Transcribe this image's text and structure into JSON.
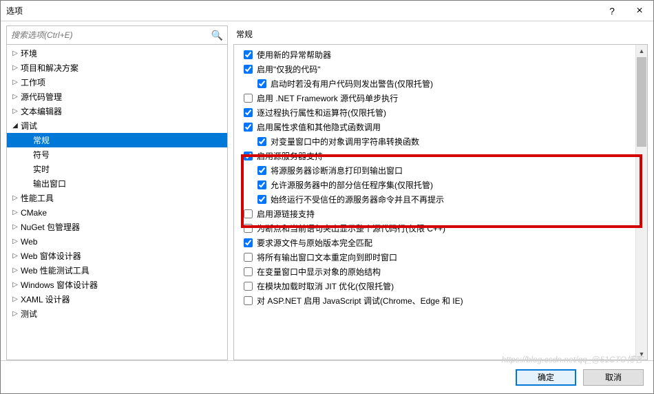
{
  "window": {
    "title": "选项",
    "help": "?",
    "close": "×"
  },
  "search": {
    "placeholder": "搜索选项(Ctrl+E)"
  },
  "tree": [
    {
      "label": "环境",
      "depth": 0,
      "expandable": true,
      "expanded": false
    },
    {
      "label": "项目和解决方案",
      "depth": 0,
      "expandable": true,
      "expanded": false
    },
    {
      "label": "工作项",
      "depth": 0,
      "expandable": true,
      "expanded": false
    },
    {
      "label": "源代码管理",
      "depth": 0,
      "expandable": true,
      "expanded": false
    },
    {
      "label": "文本编辑器",
      "depth": 0,
      "expandable": true,
      "expanded": false
    },
    {
      "label": "调试",
      "depth": 0,
      "expandable": true,
      "expanded": true
    },
    {
      "label": "常规",
      "depth": 1,
      "expandable": false,
      "selected": true
    },
    {
      "label": "符号",
      "depth": 1,
      "expandable": false
    },
    {
      "label": "实时",
      "depth": 1,
      "expandable": false
    },
    {
      "label": "输出窗口",
      "depth": 1,
      "expandable": false
    },
    {
      "label": "性能工具",
      "depth": 0,
      "expandable": true,
      "expanded": false
    },
    {
      "label": "CMake",
      "depth": 0,
      "expandable": true,
      "expanded": false
    },
    {
      "label": "NuGet 包管理器",
      "depth": 0,
      "expandable": true,
      "expanded": false
    },
    {
      "label": "Web",
      "depth": 0,
      "expandable": true,
      "expanded": false
    },
    {
      "label": "Web 窗体设计器",
      "depth": 0,
      "expandable": true,
      "expanded": false
    },
    {
      "label": "Web 性能测试工具",
      "depth": 0,
      "expandable": true,
      "expanded": false
    },
    {
      "label": "Windows 窗体设计器",
      "depth": 0,
      "expandable": true,
      "expanded": false
    },
    {
      "label": "XAML 设计器",
      "depth": 0,
      "expandable": true,
      "expanded": false
    },
    {
      "label": "测试",
      "depth": 0,
      "expandable": true,
      "expanded": false
    }
  ],
  "panel": {
    "title": "常规",
    "options": [
      {
        "label": "使用新的异常帮助器",
        "level": 0,
        "checked": true
      },
      {
        "label": "启用\"仅我的代码\"",
        "level": 0,
        "checked": true
      },
      {
        "label": "启动时若没有用户代码则发出警告(仅限托管)",
        "level": 1,
        "checked": true
      },
      {
        "label": "启用 .NET Framework 源代码单步执行",
        "level": 0,
        "checked": false
      },
      {
        "label": "逐过程执行属性和运算符(仅限托管)",
        "level": 0,
        "checked": true
      },
      {
        "label": "启用属性求值和其他隐式函数调用",
        "level": 0,
        "checked": true
      },
      {
        "label": "对变量窗口中的对象调用字符串转换函数",
        "level": 1,
        "checked": true
      },
      {
        "label": "启用源服务器支持",
        "level": 0,
        "checked": true
      },
      {
        "label": "将源服务器诊断消息打印到输出窗口",
        "level": 1,
        "checked": true
      },
      {
        "label": "允许源服务器中的部分信任程序集(仅限托管)",
        "level": 1,
        "checked": true
      },
      {
        "label": "始终运行不受信任的源服务器命令并且不再提示",
        "level": 1,
        "checked": true
      },
      {
        "label": "启用源链接支持",
        "level": 0,
        "checked": false
      },
      {
        "label": "为断点和当前语句突出显示整个源代码行(仅限 C++)",
        "level": 0,
        "checked": false
      },
      {
        "label": "要求源文件与原始版本完全匹配",
        "level": 0,
        "checked": true
      },
      {
        "label": "将所有输出窗口文本重定向到即时窗口",
        "level": 0,
        "checked": false
      },
      {
        "label": "在变量窗口中显示对象的原始结构",
        "level": 0,
        "checked": false
      },
      {
        "label": "在模块加载时取消 JIT 优化(仅限托管)",
        "level": 0,
        "checked": false
      },
      {
        "label": "对 ASP.NET 启用 JavaScript 调试(Chrome、Edge 和 IE)",
        "level": 0,
        "checked": false
      }
    ]
  },
  "buttons": {
    "ok": "确定",
    "cancel": "取消"
  },
  "watermark": "https://blog.csdn.net/qq_@51CTO博客"
}
